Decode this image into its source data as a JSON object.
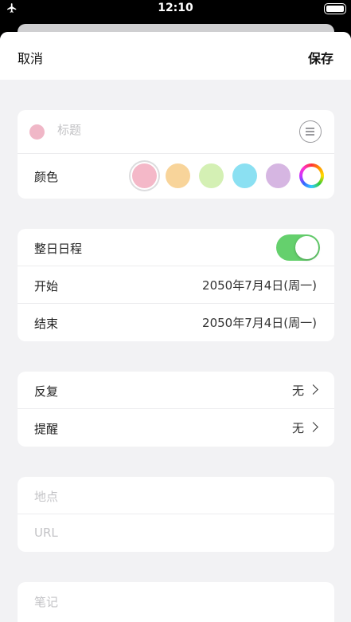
{
  "status": {
    "time": "12:10",
    "airplane_icon": "airplane-icon",
    "battery_icon": "battery-icon"
  },
  "nav": {
    "cancel": "取消",
    "save": "保存"
  },
  "title_card": {
    "placeholder": "标题",
    "dot_color": "#f0b7c7",
    "color_label": "颜色",
    "colors": [
      "#f4b8c8",
      "#f8d49a",
      "#d4f0b4",
      "#8be0f2",
      "#d6b6e2"
    ],
    "selected_color_index": 0
  },
  "time_card": {
    "all_day_label": "整日日程",
    "all_day_on": true,
    "start_label": "开始",
    "start_value": "2050年7月4日(周一)",
    "end_label": "结束",
    "end_value": "2050年7月4日(周一)"
  },
  "repeat_card": {
    "repeat_label": "反复",
    "repeat_value": "无",
    "reminder_label": "提醒",
    "reminder_value": "无"
  },
  "location_card": {
    "location_placeholder": "地点",
    "url_placeholder": "URL"
  },
  "notes_card": {
    "notes_placeholder": "笔记"
  },
  "accent_color": "#65d06d"
}
